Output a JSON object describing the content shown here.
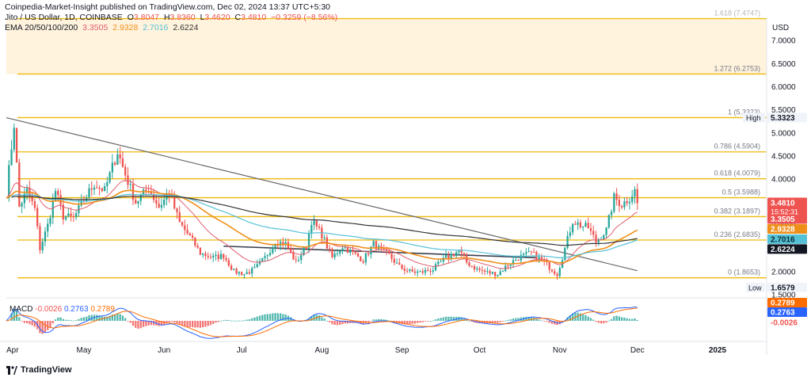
{
  "header": {
    "publisher": "Coinpedia-Market-Insight published on TradingView.com, Dec 02, 2024 13:37 UTC+5:30",
    "symbol": "Jito / US Dollar, 1D, COINBASE",
    "o_label": "O",
    "o_value": "3.8047",
    "h_label": "H",
    "h_value": "3.8360",
    "l_label": "L",
    "l_value": "3.4620",
    "c_label": "C",
    "c_value": "3.4810",
    "change": "−0.3259 (−8.56%)",
    "ema_label": "EMA 20/50/100/200",
    "ema20": "3.3505",
    "ema50": "2.9328",
    "ema100": "2.7016",
    "ema200": "2.6224"
  },
  "currency": "USD",
  "brand": "TradingView",
  "colors": {
    "up": "#26a69a",
    "down": "#ef5350",
    "fib": "#f0b90b",
    "fib_top_band": "#fff3dd",
    "ema20": "#e05d6f",
    "ema50": "#ef8f1a",
    "ema100": "#55c1d6",
    "ema200": "#333333",
    "trendline": "#666666",
    "macd": "#2962ff",
    "signal": "#ff6d00"
  },
  "chart_data": {
    "type": "candlestick",
    "title": "Jito / US Dollar, 1D, COINBASE",
    "ylim": [
      1.5,
      7.5
    ],
    "y_ticks": [
      "7.0000",
      "6.5000",
      "6.0000",
      "5.5000",
      "5.0000",
      "4.5000",
      "4.0000",
      "3.5000",
      "3.0000",
      "2.5000",
      "2.0000",
      "1.5000"
    ],
    "y_tick_values": [
      7.0,
      6.5,
      6.0,
      5.5,
      5.0,
      4.5,
      4.0,
      3.5,
      3.0,
      2.5,
      2.0,
      1.5
    ],
    "x_labels": [
      "Apr",
      "May",
      "Jun",
      "Jul",
      "Aug",
      "Sep",
      "Oct",
      "Nov",
      "Dec",
      "2025"
    ],
    "x_label_days": [
      0,
      30,
      61,
      91,
      122,
      153,
      183,
      214,
      244,
      275
    ],
    "x_range_days": [
      0,
      294
    ],
    "fib_levels": [
      {
        "label": "1.618 (7.4747)",
        "value": 7.4747
      },
      {
        "label": "1.272 (6.2753)",
        "value": 6.2753
      },
      {
        "label": "1 (5.3323)",
        "value": 5.3323
      },
      {
        "label": "0.786 (4.5904)",
        "value": 4.5904
      },
      {
        "label": "0.618 (4.0079)",
        "value": 4.0079
      },
      {
        "label": "0.5 (3.5988)",
        "value": 3.5988
      },
      {
        "label": "0.382 (3.1897)",
        "value": 3.1897
      },
      {
        "label": "0.236 (2.6835)",
        "value": 2.6835
      },
      {
        "label": "0 (1.8653)",
        "value": 1.8653
      }
    ],
    "high": {
      "label": "High",
      "value": 5.3323,
      "text": "5.3323"
    },
    "low": {
      "label": "Low",
      "value": 1.6579,
      "text": "1.6579"
    },
    "last_price": {
      "text": "3.4810",
      "value": 3.481,
      "countdown": "15:52:31"
    },
    "ema_badges": [
      {
        "name": "EMA 20",
        "text": "3.3505",
        "value": 3.3505
      },
      {
        "name": "EMA 50",
        "text": "2.9328",
        "value": 2.9328
      },
      {
        "name": "EMA 100",
        "text": "2.7016",
        "value": 2.7016
      },
      {
        "name": "EMA 200",
        "text": "2.6224",
        "value": 2.6224
      }
    ],
    "trendline": {
      "start": {
        "day": 0,
        "price": 5.33
      },
      "end": {
        "day": 244,
        "price": 2.02
      }
    },
    "support_line": {
      "start": {
        "day": 84,
        "price": 2.55
      },
      "end": {
        "day": 205,
        "price": 2.3
      }
    },
    "close_anchors": [
      [
        0,
        3.7
      ],
      [
        3,
        5.2
      ],
      [
        5,
        3.4
      ],
      [
        8,
        3.75
      ],
      [
        11,
        3.35
      ],
      [
        13,
        2.5
      ],
      [
        16,
        3.0
      ],
      [
        19,
        3.75
      ],
      [
        22,
        3.2
      ],
      [
        26,
        3.15
      ],
      [
        30,
        3.55
      ],
      [
        34,
        3.9
      ],
      [
        38,
        3.75
      ],
      [
        43,
        4.6
      ],
      [
        46,
        4.1
      ],
      [
        50,
        3.5
      ],
      [
        55,
        3.8
      ],
      [
        59,
        3.4
      ],
      [
        63,
        3.7
      ],
      [
        67,
        3.05
      ],
      [
        71,
        2.75
      ],
      [
        75,
        2.4
      ],
      [
        80,
        2.3
      ],
      [
        84,
        2.35
      ],
      [
        88,
        2.0
      ],
      [
        92,
        1.95
      ],
      [
        96,
        2.05
      ],
      [
        100,
        2.3
      ],
      [
        104,
        2.65
      ],
      [
        108,
        2.6
      ],
      [
        112,
        2.2
      ],
      [
        116,
        2.55
      ],
      [
        118,
        3.1
      ],
      [
        122,
        2.8
      ],
      [
        126,
        2.3
      ],
      [
        130,
        2.55
      ],
      [
        134,
        2.4
      ],
      [
        138,
        2.25
      ],
      [
        142,
        2.6
      ],
      [
        145,
        2.45
      ],
      [
        148,
        2.35
      ],
      [
        152,
        2.1
      ],
      [
        156,
        2.0
      ],
      [
        160,
        1.98
      ],
      [
        165,
        2.05
      ],
      [
        170,
        2.3
      ],
      [
        175,
        2.45
      ],
      [
        178,
        2.2
      ],
      [
        182,
        2.05
      ],
      [
        186,
        1.98
      ],
      [
        190,
        1.95
      ],
      [
        194,
        2.15
      ],
      [
        198,
        2.3
      ],
      [
        203,
        2.4
      ],
      [
        208,
        2.2
      ],
      [
        213,
        1.95
      ],
      [
        216,
        2.5
      ],
      [
        219,
        3.1
      ],
      [
        222,
        3.0
      ],
      [
        225,
        2.95
      ],
      [
        228,
        2.65
      ],
      [
        232,
        2.9
      ],
      [
        235,
        3.6
      ],
      [
        238,
        3.45
      ],
      [
        241,
        3.6
      ],
      [
        243,
        3.75
      ],
      [
        244,
        3.48
      ]
    ],
    "macd": {
      "label": "MACD",
      "macd_text": "-0.0026",
      "signal_text": "0.2763",
      "hist_text": "0.2789",
      "badges": [
        {
          "text": "0.2789",
          "value": 0.2789
        },
        {
          "text": "0.2763",
          "value": 0.2763
        },
        {
          "text": "-0.0026",
          "value": -0.0026
        }
      ],
      "ylim": [
        -0.45,
        0.45
      ]
    }
  }
}
